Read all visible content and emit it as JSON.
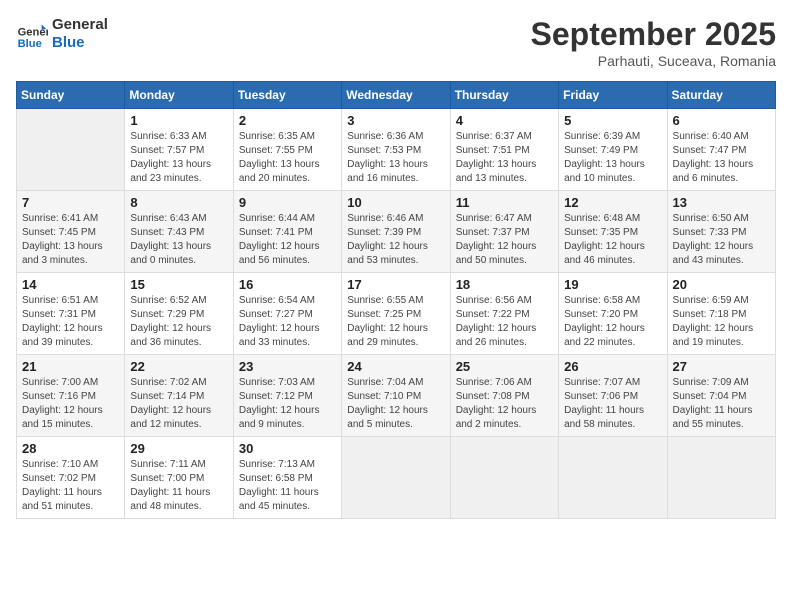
{
  "header": {
    "logo_line1": "General",
    "logo_line2": "Blue",
    "month": "September 2025",
    "location": "Parhauti, Suceava, Romania"
  },
  "weekdays": [
    "Sunday",
    "Monday",
    "Tuesday",
    "Wednesday",
    "Thursday",
    "Friday",
    "Saturday"
  ],
  "weeks": [
    [
      {
        "day": "",
        "info": ""
      },
      {
        "day": "1",
        "info": "Sunrise: 6:33 AM\nSunset: 7:57 PM\nDaylight: 13 hours\nand 23 minutes."
      },
      {
        "day": "2",
        "info": "Sunrise: 6:35 AM\nSunset: 7:55 PM\nDaylight: 13 hours\nand 20 minutes."
      },
      {
        "day": "3",
        "info": "Sunrise: 6:36 AM\nSunset: 7:53 PM\nDaylight: 13 hours\nand 16 minutes."
      },
      {
        "day": "4",
        "info": "Sunrise: 6:37 AM\nSunset: 7:51 PM\nDaylight: 13 hours\nand 13 minutes."
      },
      {
        "day": "5",
        "info": "Sunrise: 6:39 AM\nSunset: 7:49 PM\nDaylight: 13 hours\nand 10 minutes."
      },
      {
        "day": "6",
        "info": "Sunrise: 6:40 AM\nSunset: 7:47 PM\nDaylight: 13 hours\nand 6 minutes."
      }
    ],
    [
      {
        "day": "7",
        "info": "Sunrise: 6:41 AM\nSunset: 7:45 PM\nDaylight: 13 hours\nand 3 minutes."
      },
      {
        "day": "8",
        "info": "Sunrise: 6:43 AM\nSunset: 7:43 PM\nDaylight: 13 hours\nand 0 minutes."
      },
      {
        "day": "9",
        "info": "Sunrise: 6:44 AM\nSunset: 7:41 PM\nDaylight: 12 hours\nand 56 minutes."
      },
      {
        "day": "10",
        "info": "Sunrise: 6:46 AM\nSunset: 7:39 PM\nDaylight: 12 hours\nand 53 minutes."
      },
      {
        "day": "11",
        "info": "Sunrise: 6:47 AM\nSunset: 7:37 PM\nDaylight: 12 hours\nand 50 minutes."
      },
      {
        "day": "12",
        "info": "Sunrise: 6:48 AM\nSunset: 7:35 PM\nDaylight: 12 hours\nand 46 minutes."
      },
      {
        "day": "13",
        "info": "Sunrise: 6:50 AM\nSunset: 7:33 PM\nDaylight: 12 hours\nand 43 minutes."
      }
    ],
    [
      {
        "day": "14",
        "info": "Sunrise: 6:51 AM\nSunset: 7:31 PM\nDaylight: 12 hours\nand 39 minutes."
      },
      {
        "day": "15",
        "info": "Sunrise: 6:52 AM\nSunset: 7:29 PM\nDaylight: 12 hours\nand 36 minutes."
      },
      {
        "day": "16",
        "info": "Sunrise: 6:54 AM\nSunset: 7:27 PM\nDaylight: 12 hours\nand 33 minutes."
      },
      {
        "day": "17",
        "info": "Sunrise: 6:55 AM\nSunset: 7:25 PM\nDaylight: 12 hours\nand 29 minutes."
      },
      {
        "day": "18",
        "info": "Sunrise: 6:56 AM\nSunset: 7:22 PM\nDaylight: 12 hours\nand 26 minutes."
      },
      {
        "day": "19",
        "info": "Sunrise: 6:58 AM\nSunset: 7:20 PM\nDaylight: 12 hours\nand 22 minutes."
      },
      {
        "day": "20",
        "info": "Sunrise: 6:59 AM\nSunset: 7:18 PM\nDaylight: 12 hours\nand 19 minutes."
      }
    ],
    [
      {
        "day": "21",
        "info": "Sunrise: 7:00 AM\nSunset: 7:16 PM\nDaylight: 12 hours\nand 15 minutes."
      },
      {
        "day": "22",
        "info": "Sunrise: 7:02 AM\nSunset: 7:14 PM\nDaylight: 12 hours\nand 12 minutes."
      },
      {
        "day": "23",
        "info": "Sunrise: 7:03 AM\nSunset: 7:12 PM\nDaylight: 12 hours\nand 9 minutes."
      },
      {
        "day": "24",
        "info": "Sunrise: 7:04 AM\nSunset: 7:10 PM\nDaylight: 12 hours\nand 5 minutes."
      },
      {
        "day": "25",
        "info": "Sunrise: 7:06 AM\nSunset: 7:08 PM\nDaylight: 12 hours\nand 2 minutes."
      },
      {
        "day": "26",
        "info": "Sunrise: 7:07 AM\nSunset: 7:06 PM\nDaylight: 11 hours\nand 58 minutes."
      },
      {
        "day": "27",
        "info": "Sunrise: 7:09 AM\nSunset: 7:04 PM\nDaylight: 11 hours\nand 55 minutes."
      }
    ],
    [
      {
        "day": "28",
        "info": "Sunrise: 7:10 AM\nSunset: 7:02 PM\nDaylight: 11 hours\nand 51 minutes."
      },
      {
        "day": "29",
        "info": "Sunrise: 7:11 AM\nSunset: 7:00 PM\nDaylight: 11 hours\nand 48 minutes."
      },
      {
        "day": "30",
        "info": "Sunrise: 7:13 AM\nSunset: 6:58 PM\nDaylight: 11 hours\nand 45 minutes."
      },
      {
        "day": "",
        "info": ""
      },
      {
        "day": "",
        "info": ""
      },
      {
        "day": "",
        "info": ""
      },
      {
        "day": "",
        "info": ""
      }
    ]
  ]
}
